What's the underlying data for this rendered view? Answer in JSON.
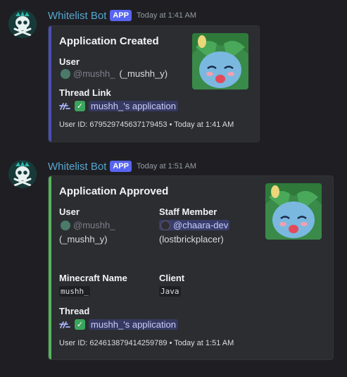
{
  "messages": [
    {
      "username": "Whitelist Bot",
      "badge": "APP",
      "timestamp": "Today at 1:41 AM",
      "embed": {
        "accent_color": "#4b4fb3",
        "title": "Application Created",
        "user_label": "User",
        "user_mention": "@mushh_",
        "user_handle": "(_mushh_y)",
        "thread_label": "Thread Link",
        "thread_name": "mushh_'s application",
        "footer": "User ID: 679529745637179453 • Today at 1:41 AM"
      }
    },
    {
      "username": "Whitelist Bot",
      "badge": "APP",
      "timestamp": "Today at 1:51 AM",
      "embed": {
        "accent_color": "#57b45c",
        "title": "Application Approved",
        "user_label": "User",
        "user_mention": "@mushh_",
        "user_handle": "(_mushh_y)",
        "staff_label": "Staff Member",
        "staff_mention": "@chaara-dev",
        "staff_handle": "(lostbrickplacer)",
        "mc_label": "Minecraft Name",
        "mc_value": "mushh_",
        "client_label": "Client",
        "client_value": "Java",
        "thread_label": "Thread",
        "thread_name": "mushh_'s application",
        "footer": "User ID: 624613879414259789 • Today at 1:51 AM"
      }
    }
  ],
  "icons": {
    "avatar": "skull-crossbones-icon",
    "thread": "thread-icon",
    "check": "check-mark-icon"
  },
  "colors": {
    "background": "#1f1f23",
    "embed_bg": "#2b2d31",
    "username": "#56a7cf",
    "app_badge": "#5865f2"
  },
  "check_glyph": "✓"
}
